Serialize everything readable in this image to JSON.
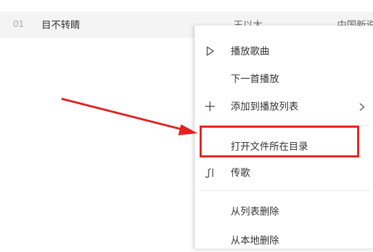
{
  "song_row": {
    "index": "01",
    "title": "目不转睛",
    "artist": "王以太",
    "album": "中国新说"
  },
  "context_menu": {
    "items": [
      {
        "label": "播放歌曲",
        "icon": "play-icon"
      },
      {
        "label": "下一首播放",
        "icon": ""
      },
      {
        "label": "添加到播放列表",
        "icon": "plus-icon",
        "submenu": "chevron-right-icon"
      },
      {
        "label": "打开文件所在目录",
        "icon": ""
      },
      {
        "label": "传歌",
        "icon": "transfer-song-icon"
      },
      {
        "label": "从列表删除",
        "icon": ""
      },
      {
        "label": "从本地删除",
        "icon": ""
      }
    ]
  },
  "annotation": {
    "color": "#e3211f",
    "target": "打开文件所在目录"
  }
}
